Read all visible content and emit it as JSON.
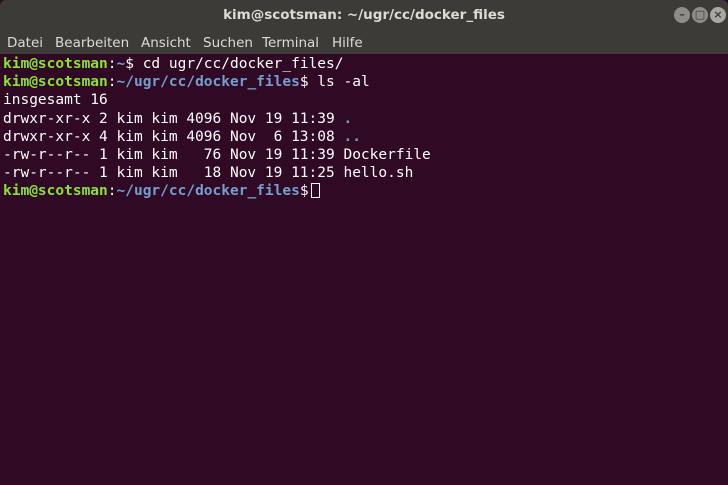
{
  "window": {
    "title": "kim@scotsman: ~/ugr/cc/docker_files",
    "buttons": {
      "minimize_icon": "minimize-icon",
      "maximize_icon": "maximize-icon",
      "close_icon": "close-icon"
    }
  },
  "menubar": {
    "items": [
      "Datei",
      "Bearbeiten",
      "Ansicht",
      "Suchen",
      "Terminal",
      "Hilfe"
    ]
  },
  "colors": {
    "terminal_bg": "#300a24",
    "prompt_user": "#8ae234",
    "prompt_path": "#729fcf",
    "text": "#ffffff"
  },
  "terminal": {
    "prompt1": {
      "user": "kim@scotsman",
      "path": "~",
      "command": " cd ugr/cc/docker_files/"
    },
    "prompt2": {
      "user": "kim@scotsman",
      "path": "~/ugr/cc/docker_files",
      "command": " ls -al"
    },
    "total_line": "insgesamt 16",
    "listing": [
      {
        "meta": "drwxr-xr-x 2 kim kim 4096 Nov 19 11:39 ",
        "name": ".",
        "is_dir": true
      },
      {
        "meta": "drwxr-xr-x 4 kim kim 4096 Nov  6 13:08 ",
        "name": "..",
        "is_dir": true
      },
      {
        "meta": "-rw-r--r-- 1 kim kim   76 Nov 19 11:39 ",
        "name": "Dockerfile",
        "is_dir": false
      },
      {
        "meta": "-rw-r--r-- 1 kim kim   18 Nov 19 11:25 ",
        "name": "hello.sh",
        "is_dir": false
      }
    ],
    "prompt3": {
      "user": "kim@scotsman",
      "path": "~/ugr/cc/docker_files",
      "command": " "
    }
  }
}
